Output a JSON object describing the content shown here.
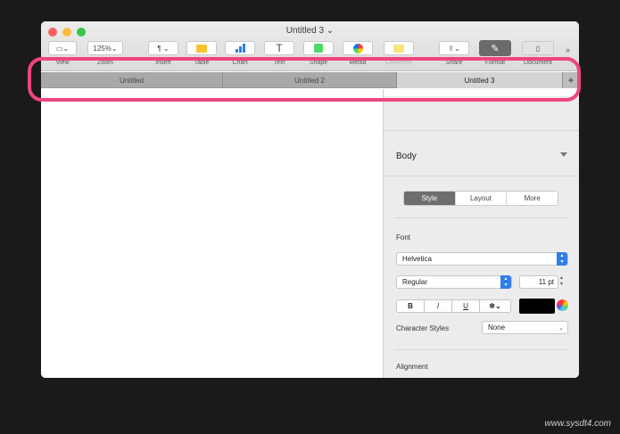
{
  "window": {
    "title": "Untitled 3",
    "title_chevron": "⌄"
  },
  "toolbar": {
    "view": {
      "label": "View"
    },
    "zoom": {
      "label": "Zoom",
      "value": "125%"
    },
    "insert": {
      "label": "Insert",
      "glyph": "¶"
    },
    "table": {
      "label": "Table"
    },
    "chart": {
      "label": "Chart"
    },
    "text": {
      "label": "Text",
      "glyph": "T"
    },
    "shape": {
      "label": "Shape"
    },
    "media": {
      "label": "Media"
    },
    "comment": {
      "label": "Comment"
    },
    "share": {
      "label": "Share"
    },
    "format": {
      "label": "Format"
    },
    "document": {
      "label": "Document"
    },
    "overflow": "»"
  },
  "tabs": [
    {
      "label": "Untitled",
      "active": false
    },
    {
      "label": "Untitled 2",
      "active": false
    },
    {
      "label": "Untitled 3",
      "active": true
    }
  ],
  "tab_add": "+",
  "format_panel": {
    "paragraph_style": "Body",
    "segments": [
      "Style",
      "Layout",
      "More"
    ],
    "font_label": "Font",
    "font_family": "Helvetica",
    "font_typeface": "Regular",
    "font_size": "11 pt",
    "bold": "B",
    "italic": "I",
    "underline": "U",
    "gear": "✲⌄",
    "character_styles_label": "Character Styles",
    "character_styles_value": "None",
    "alignment_label": "Alignment",
    "alignment_icons": [
      "☰",
      "☰",
      "☰",
      "☰"
    ]
  },
  "colors": {
    "accent": "#2f7ee8",
    "highlight": "#f0457f",
    "text_color": "#000000"
  },
  "watermark": "www.sysdt4.com"
}
